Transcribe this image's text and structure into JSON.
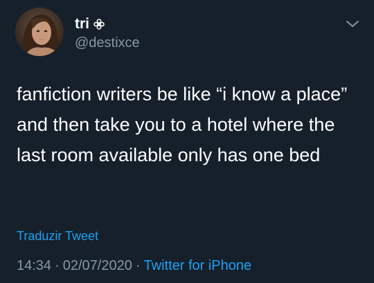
{
  "user": {
    "display_name": "tri",
    "handle": "@destixce",
    "badge_icon": "flower-icon",
    "avatar": "avatar"
  },
  "tweet": {
    "text": "fanfiction writers be like “i know a place” and then take you to a hotel where the last room available only has one bed",
    "translate_label": "Traduzir Tweet",
    "time": "14:34",
    "date": "02/07/2020",
    "separator": "·",
    "source": "Twitter for iPhone"
  },
  "icons": {
    "menu": "chevron-down-icon"
  },
  "colors": {
    "background": "#15202b",
    "primary_text": "#ffffff",
    "secondary_text": "#8899a6",
    "link": "#1da1f2"
  }
}
